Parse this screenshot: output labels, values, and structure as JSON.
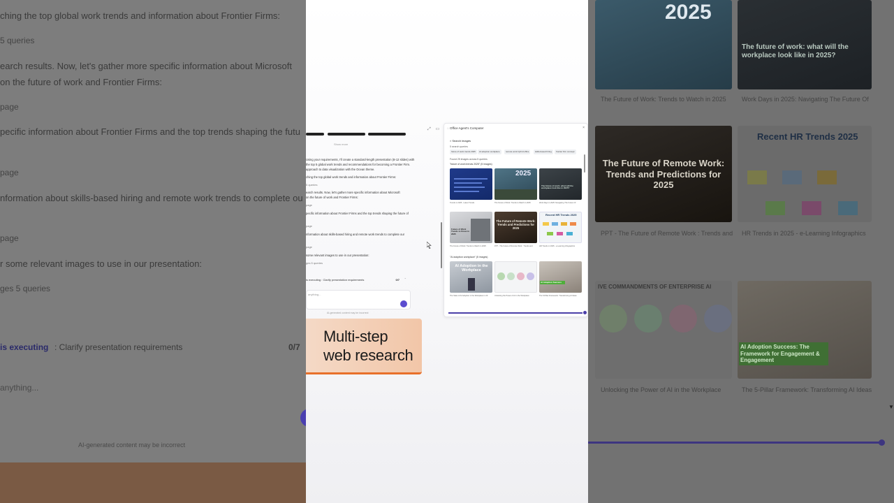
{
  "background_left": {
    "lines": [
      "ching the top global work trends and information about Frontier Firms:",
      "5 queries",
      "earch results. Now, let's gather more specific information about Microsoft",
      "on the future of work and Frontier Firms:",
      "page",
      "pecific information about Frontier Firms and the top trends shaping the futu",
      "page",
      "nformation about skills-based hiring and remote work trends to complete ou",
      "page",
      "r some relevant images to use in our presentation:",
      "ges  5 queries"
    ],
    "status_label": "is executing",
    "status_task": ": Clarify presentation requirements",
    "status_count": "0/7",
    "input_placeholder": "anything...",
    "disclaimer": "AI-generated content may be incorrect"
  },
  "background_right": {
    "tiles": [
      {
        "title": "2025",
        "caption": "The Future of Work: Trends to Watch in 2025"
      },
      {
        "title": "The future of work: what will the workplace look like in 2025?",
        "caption": "Work Days in 2025: Navigating The Future Of"
      },
      {
        "title": "The Future of Remote Work: Trends and Predictions for 2025",
        "caption": "PPT - The Future of Remote Work : Trends and"
      },
      {
        "title": "Recent HR Trends 2025",
        "caption": "HR Trends in 2025 - e-Learning Infographics"
      },
      {
        "title": "IVE COMMANDMENTS OF ENTERPRISE AI",
        "caption": "Unlocking the Power of AI in the Workplace"
      },
      {
        "title": "AI Adoption Success: The Framework for Engagement & Engagement",
        "caption": "The 5-Pillar Framework: Transforming AI Ideas"
      }
    ]
  },
  "chat": {
    "show_more": "Show more",
    "lines": [
      "Using your requirements, I'll create a standard-length presentation (8-12 slides) with",
      "the top 5 global work trends and recommendations for becoming a Frontier Firm.",
      "approach to data visualization with the Ocean theme.",
      "ching the top global work trends and information about Frontier Firms:",
      "5 queries",
      "earch results. Now, let's gather more specific information about Microsoft",
      "on the future of work and Frontier Firms:",
      "page",
      "pecific information about Frontier Firms and the top trends shaping the future of",
      "page",
      "nformation about skills-based hiring and remote work trends to complete our",
      "page",
      "some relevant images to use in our presentation:",
      "ges  5 queries"
    ],
    "status": "is executing : Clarify presentation requirements",
    "status_count": "0/7",
    "input_placeholder": "anything...",
    "disclaimer": "AI-generated content may be incorrect"
  },
  "computer": {
    "title": "Office Agent's Computer",
    "subtitle": "Search images",
    "queries_label": "5 search queries",
    "queries": [
      "future of work trends 2025",
      "AI adoption workplace",
      "remote work hybrid office",
      "skills-based hiring",
      "frontier firm concept"
    ],
    "found": "Found 25 images across 5 queries",
    "group1": "\"future of work trends 2025\" (5 images)",
    "group2": "\"AI adoption workplace\" (5 images)",
    "images": [
      {
        "title": "",
        "caption": "Trends in 2025 - Latest Trends"
      },
      {
        "title": "2025",
        "caption": "The Future of Work: Trends to Watch in 2025"
      },
      {
        "title": "The future of work: what will the workplace look like in 2025?",
        "caption": "Work Days in 2025: Navigating The Future Of"
      },
      {
        "title": "Future of Work Trends to Know in 2025",
        "caption": "The Future of Work: Trends to Watch in 2025"
      },
      {
        "title": "The Future of Remote Work: Trends and Predictions for 2025",
        "caption": "PPT - The Future of Remote Work : Trends and"
      },
      {
        "title": "Recent HR Trends 2025",
        "caption": "HR Trends in 2025 - e-Learning Infographics"
      },
      {
        "title": "AI Adoption in the Workplace",
        "caption": "The State of AI Adoption in the Workplace in 20"
      },
      {
        "title": "",
        "caption": "Unlocking the Power of AI in the Workplace"
      },
      {
        "title": "AI Adoption Success",
        "caption": "The 5-Pillar Framework: Transforming AI Ideas"
      }
    ]
  },
  "label_card": {
    "line1": "Multi-step",
    "line2": "web research"
  },
  "colors": {
    "accent": "#5b4ccf",
    "orange": "#e8702a"
  }
}
